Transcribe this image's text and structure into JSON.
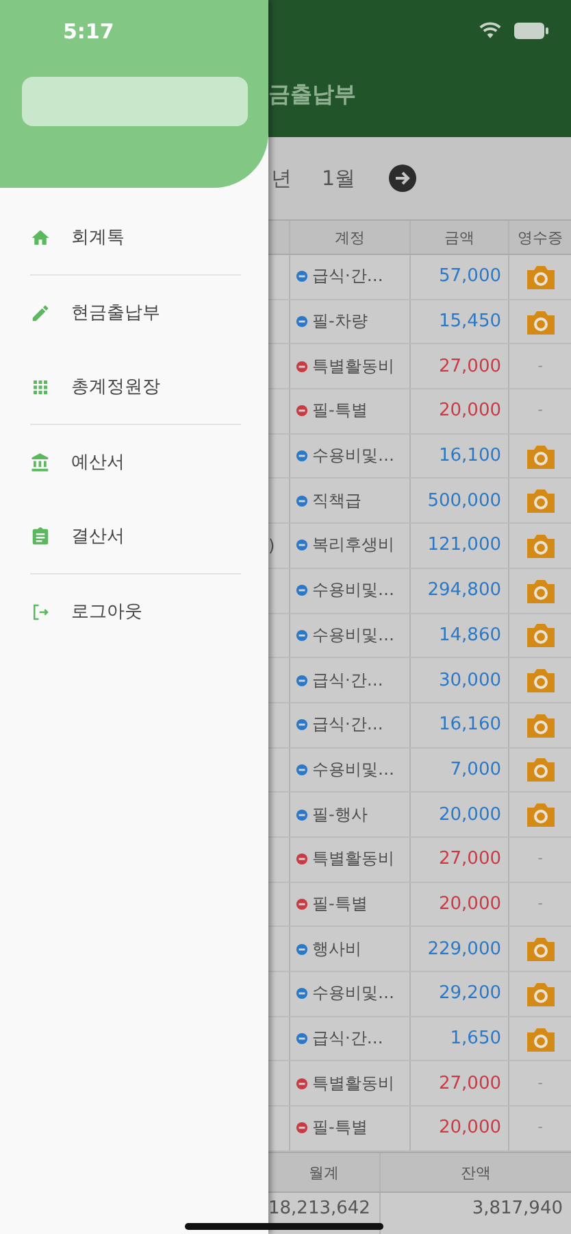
{
  "status_bar": {
    "time": "5:17"
  },
  "drawer": {
    "groups": [
      [
        {
          "label": "회계톡"
        }
      ],
      [
        {
          "label": "현금출납부"
        },
        {
          "label": "총계정원장"
        }
      ],
      [
        {
          "label": "예산서"
        },
        {
          "label": "결산서"
        }
      ],
      [
        {
          "label": "로그아웃"
        }
      ]
    ]
  },
  "background": {
    "title": "금출납부",
    "period": {
      "year": "년",
      "month": "1월"
    },
    "table": {
      "columns": [
        "계정",
        "금액",
        "영수증"
      ],
      "rows": [
        {
          "account": "급식·간…",
          "amount": "57,000",
          "color": "#2a78c8",
          "receipt": true
        },
        {
          "account": "필-차량",
          "amount": "15,450",
          "color": "#2a78c8",
          "receipt": true
        },
        {
          "account": "특별활동비",
          "amount": "27,000",
          "color": "#c83a44",
          "receipt": false,
          "receipt_mark": "-"
        },
        {
          "account": "필-특별",
          "amount": "20,000",
          "color": "#c83a44",
          "receipt": false,
          "receipt_mark": "-"
        },
        {
          "account": "수용비및…",
          "amount": "16,100",
          "color": "#2a78c8",
          "receipt": true
        },
        {
          "account": "직책급",
          "amount": "500,000",
          "color": "#2a78c8",
          "receipt": true
        },
        {
          "column_1": ")",
          "account": "복리후생비",
          "amount": "121,000",
          "color": "#2a78c8",
          "receipt": true
        },
        {
          "account": "수용비및…",
          "amount": "294,800",
          "color": "#2a78c8",
          "receipt": true
        },
        {
          "account": "수용비및…",
          "amount": "14,860",
          "color": "#2a78c8",
          "receipt": true
        },
        {
          "account": "급식·간…",
          "amount": "30,000",
          "color": "#2a78c8",
          "receipt": true
        },
        {
          "account": "급식·간…",
          "amount": "16,160",
          "color": "#2a78c8",
          "receipt": true
        },
        {
          "account": "수용비및…",
          "amount": "7,000",
          "color": "#2a78c8",
          "receipt": true
        },
        {
          "account": "필-행사",
          "amount": "20,000",
          "color": "#2a78c8",
          "receipt": true
        },
        {
          "account": "특별활동비",
          "amount": "27,000",
          "color": "#c83a44",
          "receipt": false,
          "receipt_mark": "-"
        },
        {
          "account": "필-특별",
          "amount": "20,000",
          "color": "#c83a44",
          "receipt": false,
          "receipt_mark": "-"
        },
        {
          "account": "행사비",
          "amount": "229,000",
          "color": "#2a78c8",
          "receipt": true
        },
        {
          "account": "수용비및…",
          "amount": "29,200",
          "color": "#2a78c8",
          "receipt": true
        },
        {
          "account": "급식·간…",
          "amount": "1,650",
          "color": "#2a78c8",
          "receipt": true
        },
        {
          "account": "특별활동비",
          "amount": "27,000",
          "color": "#c83a44",
          "receipt": false,
          "receipt_mark": "-"
        },
        {
          "account": "필-특별",
          "amount": "20,000",
          "color": "#c83a44",
          "receipt": false,
          "receipt_mark": "-"
        }
      ]
    },
    "totals": {
      "columns": [
        "월계",
        "잔액"
      ],
      "values": [
        "18,213,642",
        "3,817,940"
      ]
    }
  }
}
